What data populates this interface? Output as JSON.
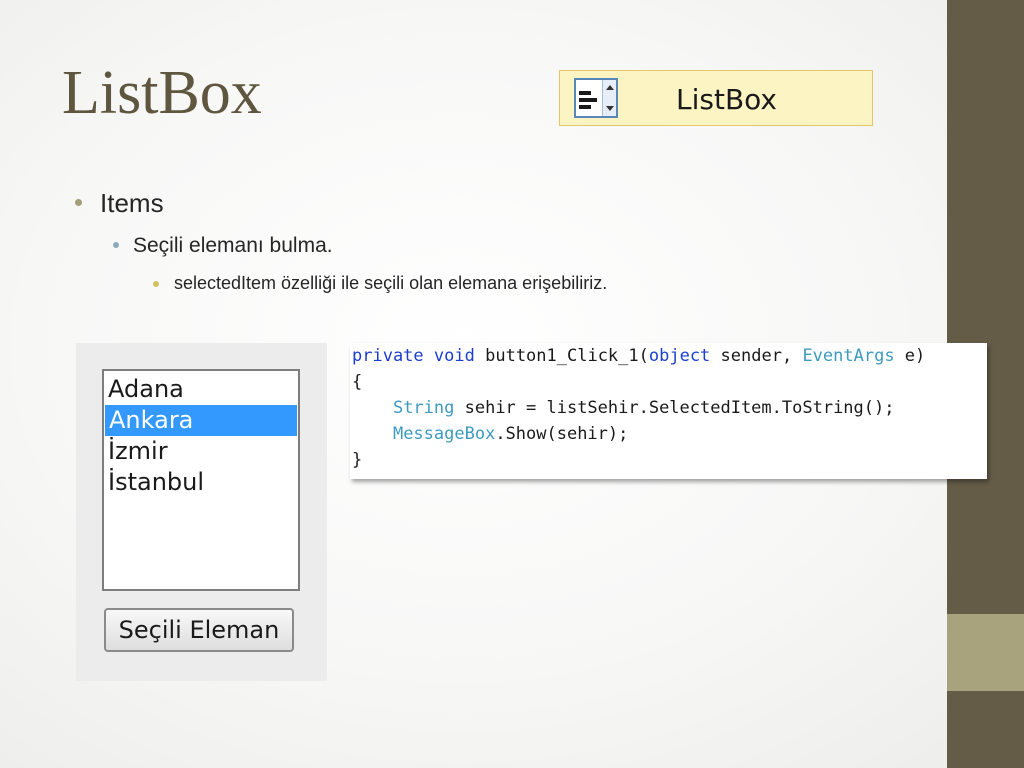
{
  "slide": {
    "title": "ListBox"
  },
  "toolbox": {
    "icon": "listbox-icon",
    "label": "ListBox"
  },
  "bullets": {
    "level1": "Items",
    "level2": "Seçili elemanı bulma.",
    "level3": "selectedItem özelliği ile seçili olan elemana erişebiliriz."
  },
  "form": {
    "listbox_items": [
      "Adana",
      "Ankara",
      "İzmir",
      "İstanbul"
    ],
    "selected_item": "Ankara",
    "button_label": "Seçili Eleman"
  },
  "code": {
    "line1": {
      "kw_private": "private",
      "kw_void": "void",
      "method": "button1_Click_1(",
      "kw_object": "object",
      "sender": "sender, ",
      "type_eventargs": "EventArgs",
      "e": " e)"
    },
    "line2": "{",
    "line3": {
      "type_string": "String",
      "rest": " sehir = listSehir.SelectedItem.ToString();"
    },
    "line4": {
      "type_messagebox": "MessageBox",
      "rest": ".Show(sehir);"
    },
    "line5": "}"
  },
  "colors": {
    "title": "#5f5640",
    "side_band": "#655c48",
    "side_accent": "#a8a27d",
    "keyword": "#1a3fcf",
    "type": "#3d9bbf",
    "selection": "#3399ff"
  }
}
